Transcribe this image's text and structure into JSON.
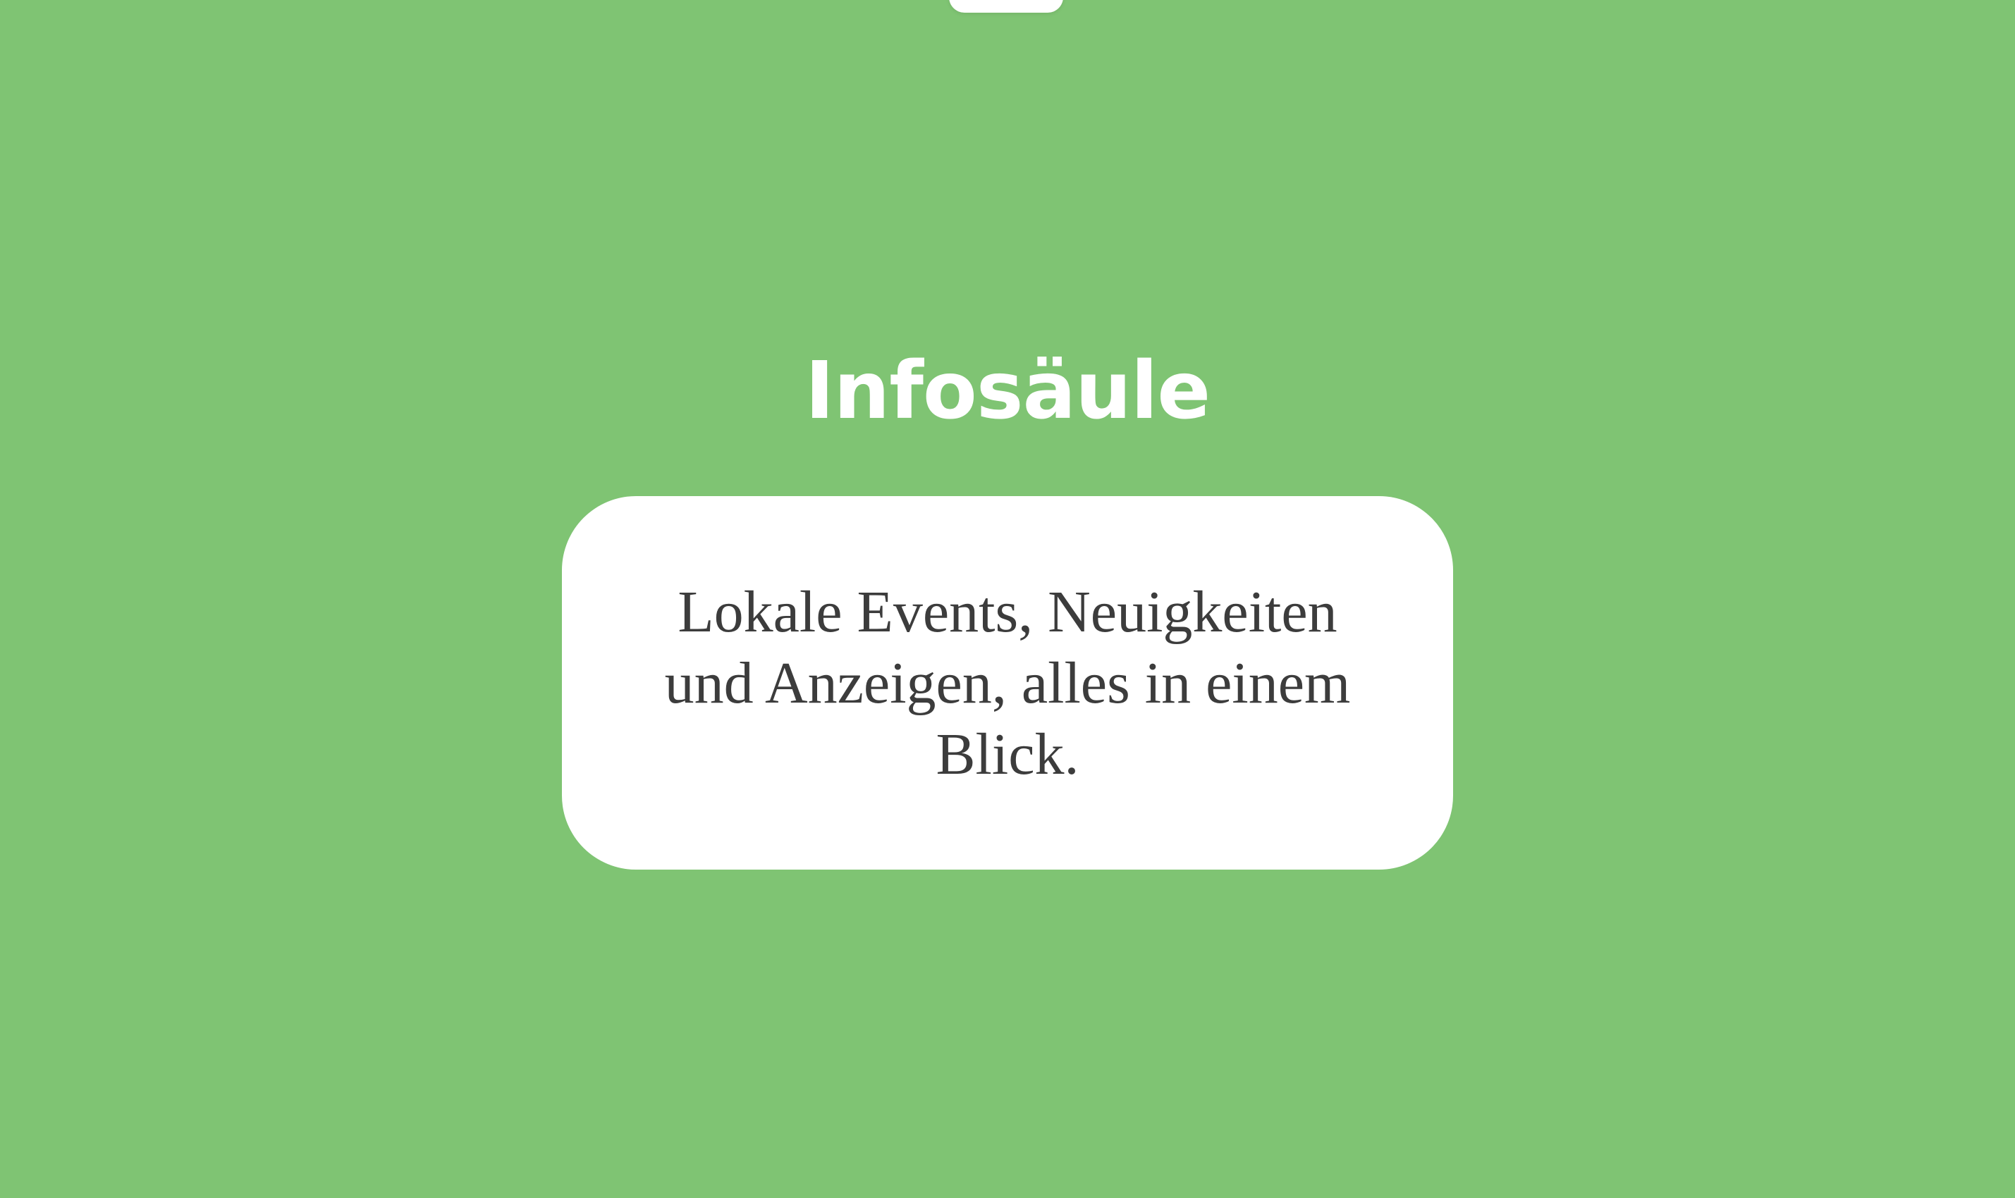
{
  "page": {
    "title": "Infosäule",
    "background_color": "#7fc473"
  },
  "info_card": {
    "text": "Lokale Events, Neuigkeiten und Anzeigen, alles in einem Blick.",
    "background_color": "#ffffff",
    "text_color": "#3c3c3c"
  }
}
